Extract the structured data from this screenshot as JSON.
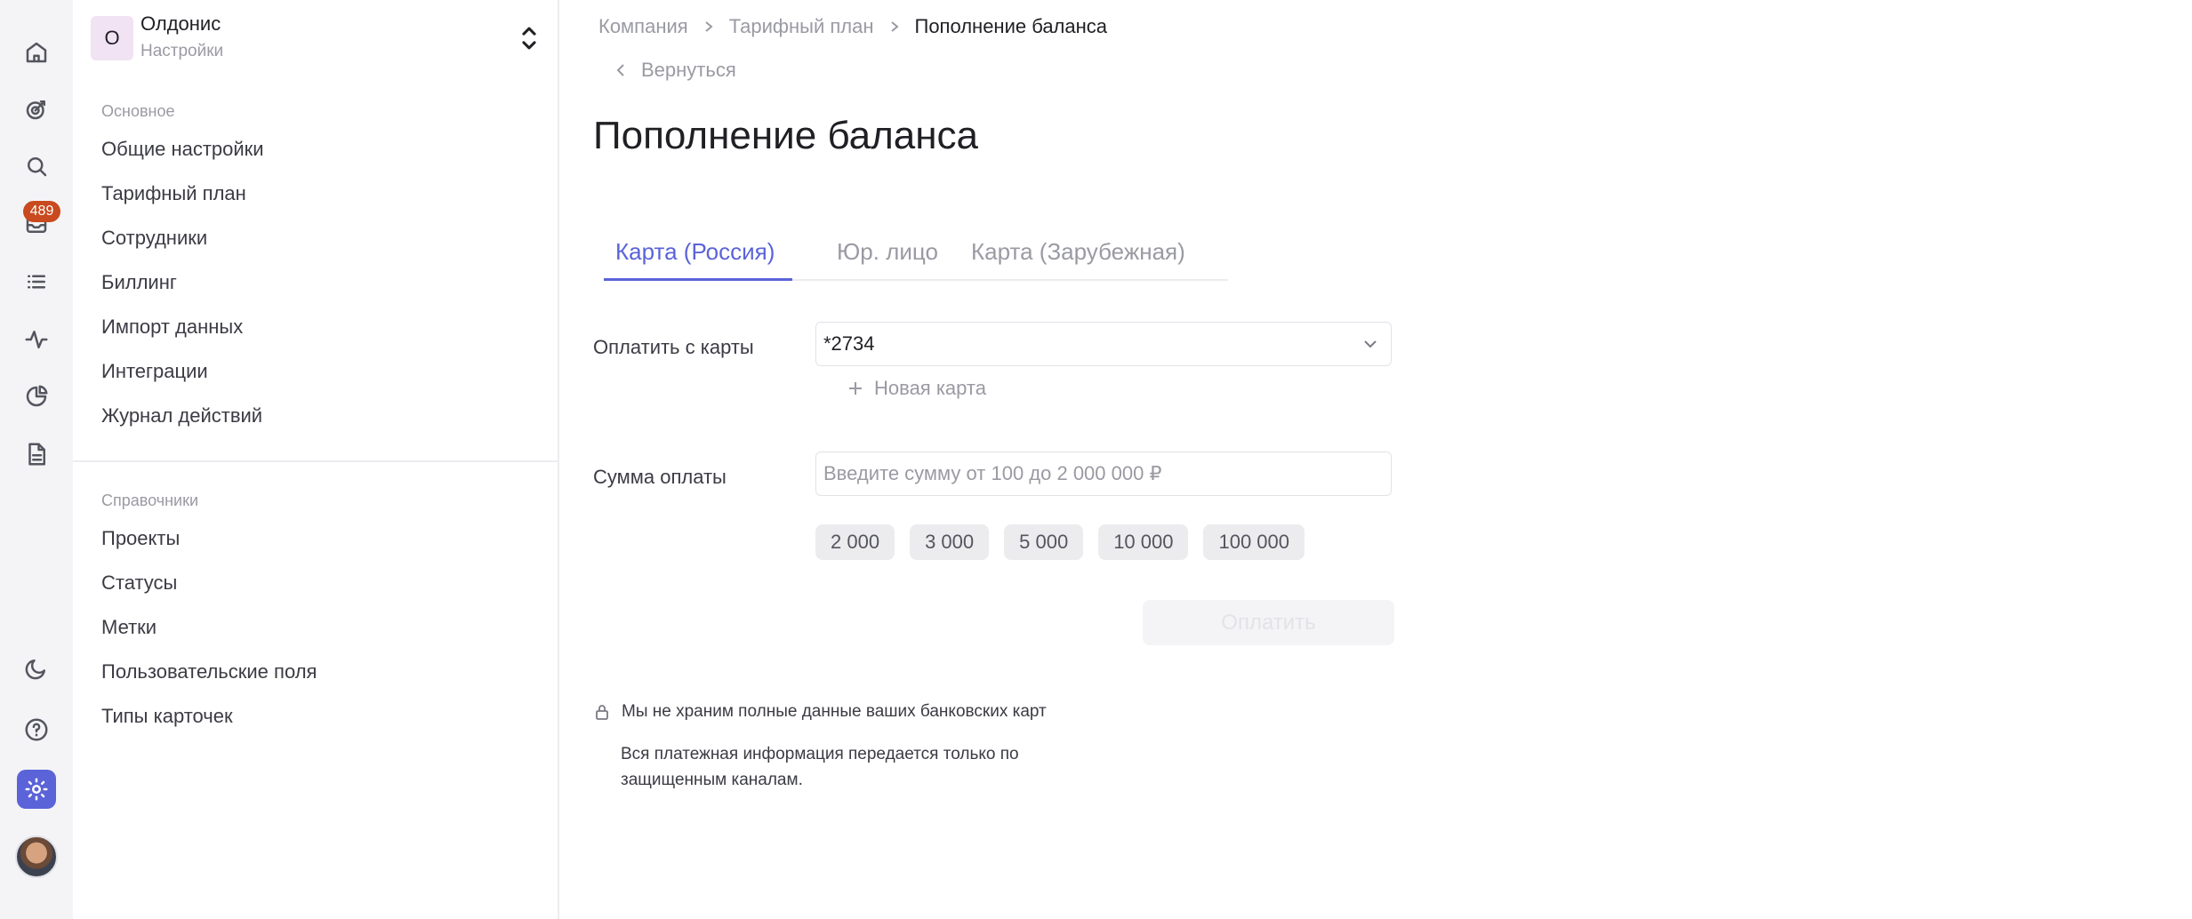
{
  "rail": {
    "items": [
      {
        "name": "home-icon"
      },
      {
        "name": "goals-icon"
      },
      {
        "name": "search-icon"
      },
      {
        "name": "inbox-icon"
      },
      {
        "name": "list-icon"
      },
      {
        "name": "activity-icon"
      },
      {
        "name": "analytics-icon"
      },
      {
        "name": "document-icon"
      }
    ],
    "inbox_badge": "489",
    "bottom": [
      {
        "name": "theme-moon-icon"
      },
      {
        "name": "help-icon"
      },
      {
        "name": "settings-icon",
        "active": true
      }
    ],
    "accent_color": "#5b63d9",
    "badge_color": "#c84a1e"
  },
  "sidebar": {
    "org_initial": "О",
    "org_name": "Олдонис",
    "org_subtitle": "Настройки",
    "section_main": "Основное",
    "main_items": [
      "Общие настройки",
      "Тарифный план",
      "Сотрудники",
      "Биллинг",
      "Импорт данных",
      "Интеграции",
      "Журнал действий"
    ],
    "section_refs": "Справочники",
    "ref_items": [
      "Проекты",
      "Статусы",
      "Метки",
      "Пользовательские поля",
      "Типы карточек"
    ]
  },
  "breadcrumb": {
    "items": [
      "Компания",
      "Тарифный план",
      "Пополнение баланса"
    ]
  },
  "back_label": "Вернуться",
  "page_title": "Пополнение баланса",
  "tabs": [
    {
      "label": "Карта (Россия)",
      "active": true
    },
    {
      "label": "Юр. лицо",
      "active": false
    },
    {
      "label": "Карта (Зарубежная)",
      "active": false
    }
  ],
  "form": {
    "card_label": "Оплатить с карты",
    "card_value": "*2734",
    "new_card_label": "Новая карта",
    "amount_label": "Сумма оплаты",
    "amount_placeholder": "Введите сумму от 100 до 2 000 000 ₽",
    "amount_value": "",
    "quick_amounts": [
      "2 000",
      "3 000",
      "5 000",
      "10 000",
      "100 000"
    ],
    "pay_button": "Оплатить"
  },
  "security_note": {
    "line1": "Мы не храним полные данные ваших банковских карт",
    "line2": "Вся платежная информация передается только по защищенным каналам."
  }
}
